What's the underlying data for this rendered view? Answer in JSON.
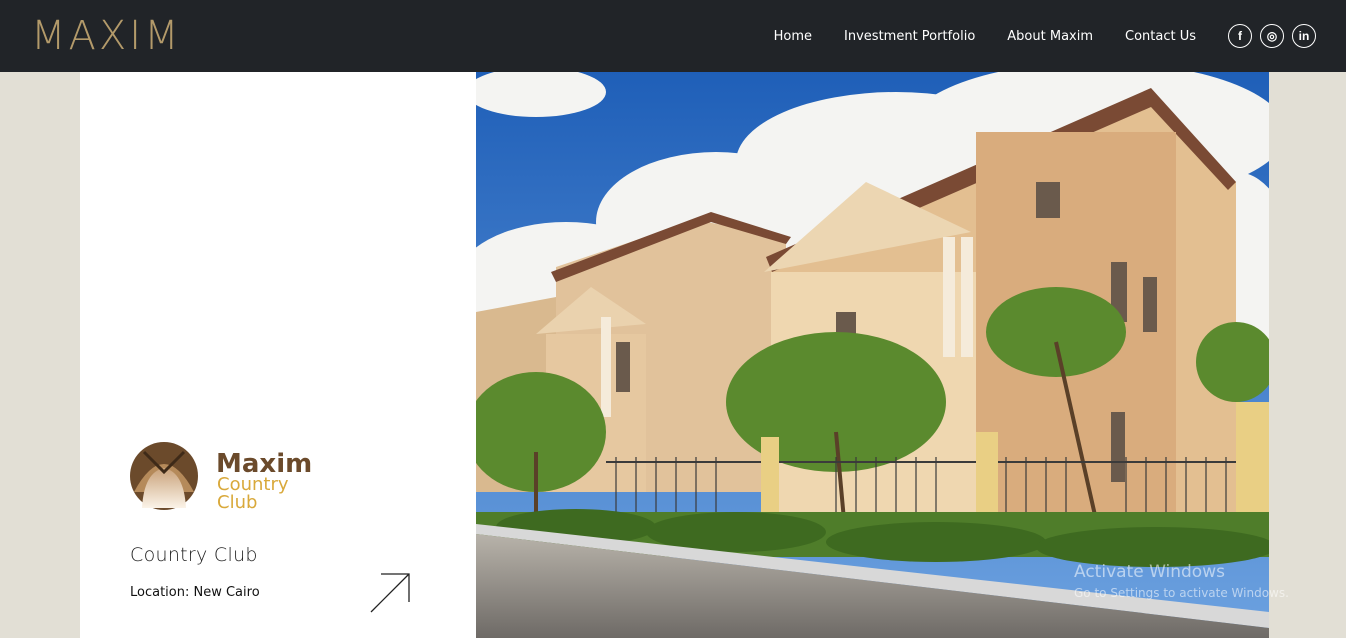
{
  "header": {
    "logo": "MAXIM",
    "nav": [
      "Home",
      "Investment Portfolio",
      "About Maxim",
      "Contact Us"
    ],
    "social": [
      {
        "icon": "facebook-icon",
        "glyph": "f"
      },
      {
        "icon": "instagram-icon",
        "glyph": "◎"
      },
      {
        "icon": "linkedin-icon",
        "glyph": "in"
      }
    ]
  },
  "project": {
    "logo_line1": "Maxim",
    "logo_line2": "Country",
    "logo_line3": "Club",
    "title": "Country Club",
    "location": "Location: New Cairo",
    "arrow_icon": "arrow-up-right-icon"
  },
  "colors": {
    "header_bg": "#212428",
    "accent_gold": "#b39a6a",
    "logo_brown": "#6b4a2b",
    "logo_gold": "#d9a93b",
    "page_bg": "#e2dfd5"
  },
  "watermark": {
    "line1": "Activate Windows",
    "line2": "Go to Settings to activate Windows."
  }
}
